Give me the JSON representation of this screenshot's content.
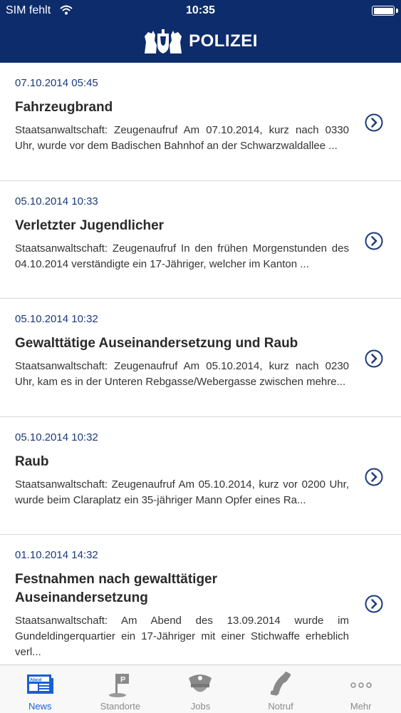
{
  "status": {
    "carrier": "SIM fehlt",
    "time": "10:35"
  },
  "header": {
    "title": "POLIZEI"
  },
  "news": [
    {
      "date": "07.10.2014 05:45",
      "title": "Fahrzeugbrand",
      "text": "Staatsanwaltschaft: Zeugenaufruf Am 07.10.2014, kurz nach 0330 Uhr, wurde vor dem Badischen Bahnhof an der Schwarzwaldallee ..."
    },
    {
      "date": "05.10.2014 10:33",
      "title": "Verletzter Jugendlicher",
      "text": "Staatsanwaltschaft: Zeugenaufruf In den frühen Morgenstunden des 04.10.2014 verständigte ein 17-Jähriger, welcher im Kanton ..."
    },
    {
      "date": "05.10.2014 10:32",
      "title": "Gewalttätige Auseinandersetzung und Raub",
      "text": "Staatsanwaltschaft: Zeugenaufruf Am 05.10.2014, kurz nach 0230 Uhr, kam es in der Unteren Rebgasse/Webergasse zwischen mehre..."
    },
    {
      "date": "05.10.2014 10:32",
      "title": "Raub",
      "text": "Staatsanwaltschaft: Zeugenaufruf Am 05.10.2014, kurz vor 0200 Uhr, wurde beim Claraplatz ein 35-jähriger Mann Opfer eines Ra..."
    },
    {
      "date": "01.10.2014 14:32",
      "title": "Festnahmen nach gewalttätiger Auseinandersetzung",
      "text": "Staatsanwaltschaft: Am Abend des 13.09.2014 wurde im Gundeldingerquartier ein 17-Jähriger mit einer Stichwaffe erheblich verl..."
    }
  ],
  "tabs": [
    {
      "label": "News",
      "icon": "newspaper-icon",
      "active": true
    },
    {
      "label": "Standorte",
      "icon": "location-flag-icon",
      "active": false
    },
    {
      "label": "Jobs",
      "icon": "police-cap-icon",
      "active": false
    },
    {
      "label": "Notruf",
      "icon": "phone-icon",
      "active": false
    },
    {
      "label": "Mehr",
      "icon": "more-dots-icon",
      "active": false
    }
  ],
  "colors": {
    "header": "#0d2c6b",
    "date": "#1a3b7a",
    "active_tab": "#1a5fd1",
    "inactive_tab": "#8a8a8a"
  }
}
